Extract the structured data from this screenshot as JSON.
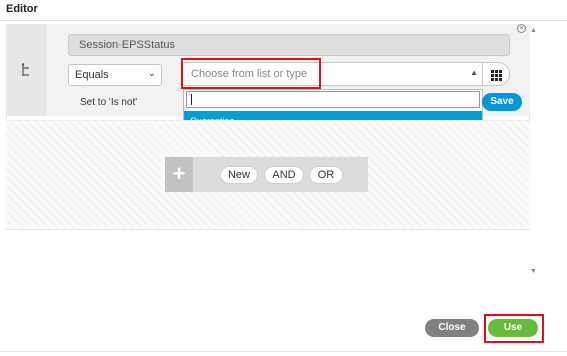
{
  "dialog": {
    "title": "Editor"
  },
  "condition": {
    "attribute": "Session·EPSStatus",
    "operator": "Equals",
    "set_to": "Set to 'Is not'",
    "value_placeholder": "Choose from list or type",
    "save_label": "Save"
  },
  "dropdown": {
    "search_value": "",
    "options": [
      {
        "label": "Quarantine",
        "selected": true
      }
    ]
  },
  "add_bar": {
    "new_label": "New",
    "and_label": "AND",
    "or_label": "OR"
  },
  "footer": {
    "close_label": "Close",
    "use_label": "Use"
  },
  "colors": {
    "accent_blue": "#0a96d6",
    "option_highlight": "#00a0d6",
    "use_green": "#66bb3a",
    "close_gray": "#808080",
    "annotation_red": "#d91414"
  },
  "icons": {
    "tree": "tree-icon",
    "grid": "grid-icon",
    "close": "close-icon",
    "plus": "plus-icon",
    "dropdown_chevron": "chevron-down-icon",
    "value_arrow": "arrow-up-icon"
  }
}
